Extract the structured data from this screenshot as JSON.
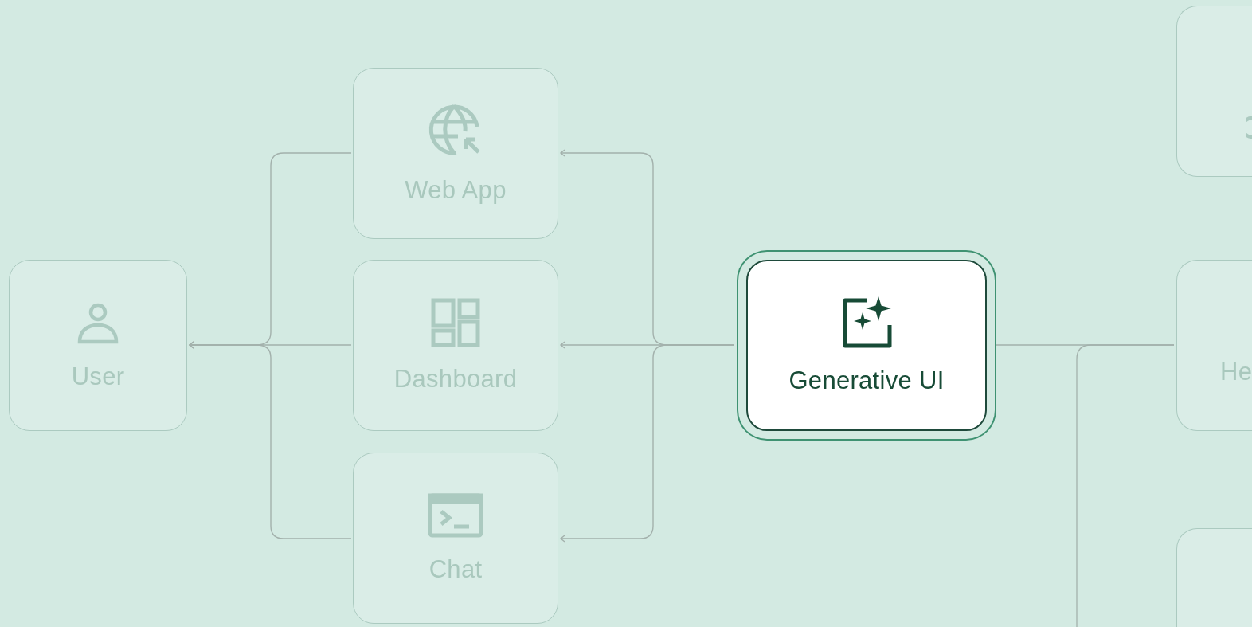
{
  "diagram": {
    "nodes": [
      {
        "label": "User",
        "highlighted": false
      },
      {
        "label": "Web App",
        "highlighted": false
      },
      {
        "label": "Dashboard",
        "highlighted": false
      },
      {
        "label": "Chat",
        "highlighted": false
      },
      {
        "label": "Generative UI",
        "highlighted": true
      },
      {
        "highlighted": false
      },
      {
        "label": "He",
        "highlighted": false
      },
      {
        "highlighted": false
      }
    ]
  }
}
